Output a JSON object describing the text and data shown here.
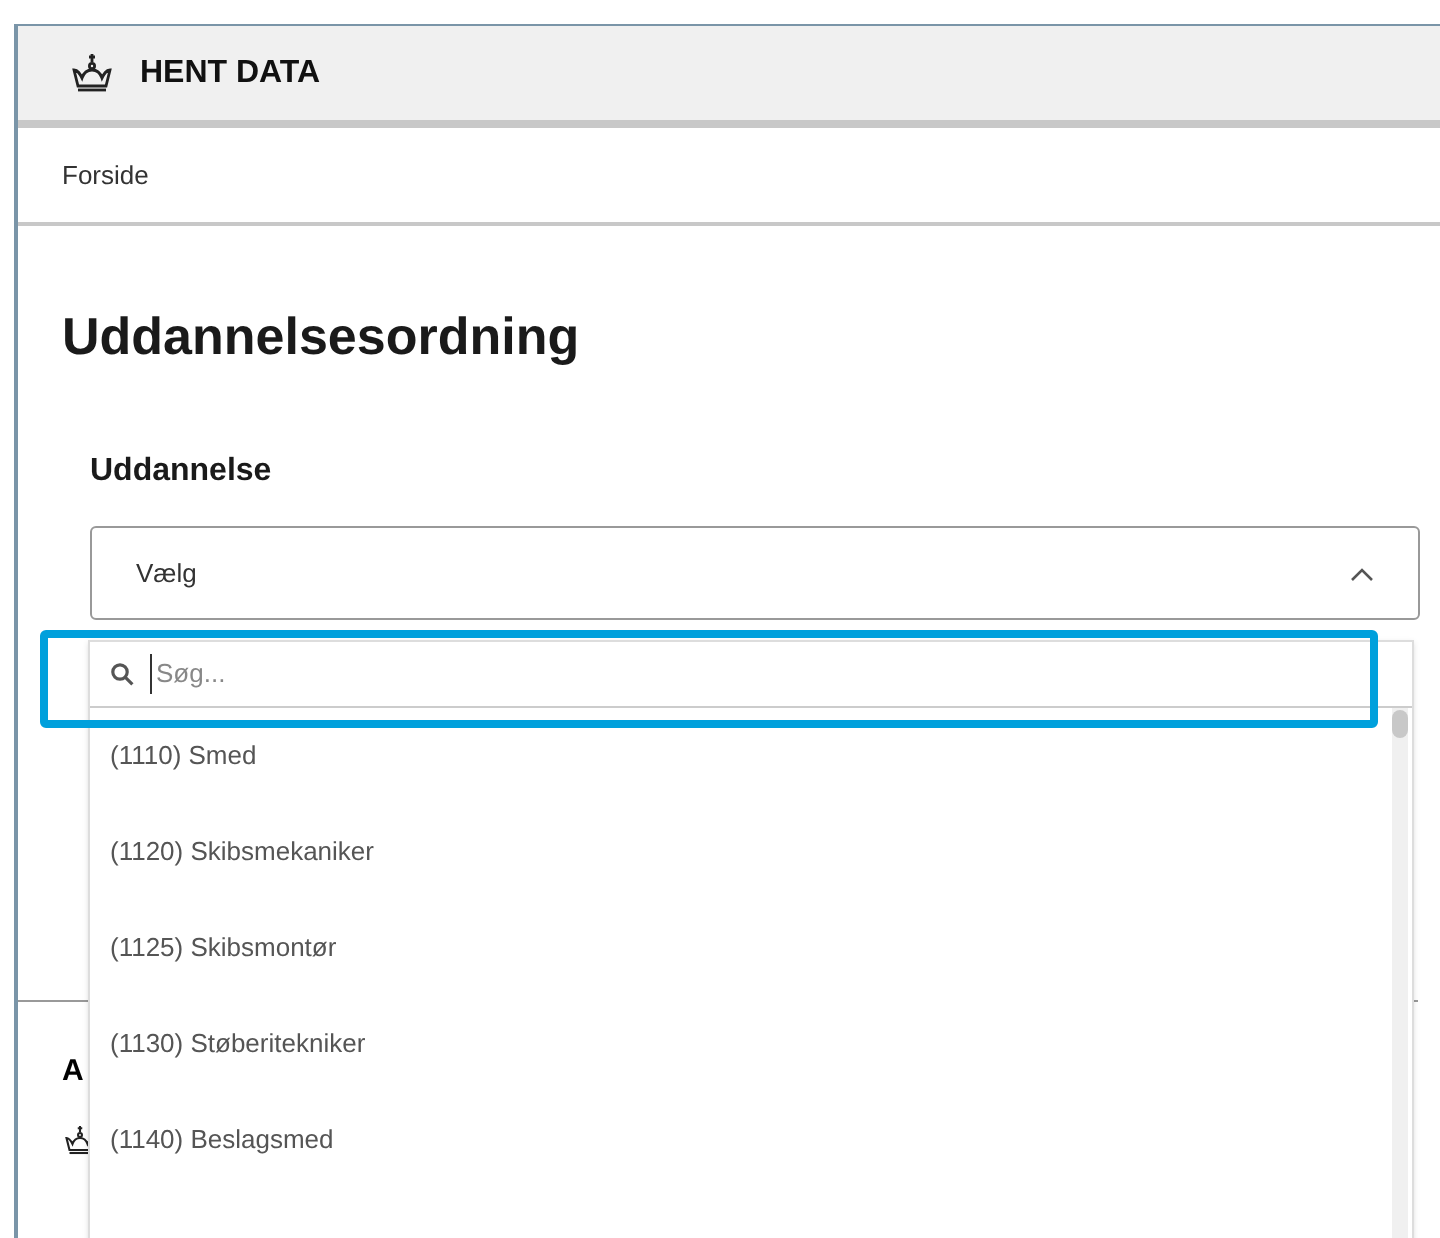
{
  "header": {
    "title": "HENT DATA"
  },
  "breadcrumb": [
    "Forside"
  ],
  "page_title": "Uddannelsesordning",
  "field": {
    "label": "Uddannelse",
    "value": "Vælg",
    "expanded": true
  },
  "footer": {
    "heading": "A"
  },
  "dropdown": {
    "search": {
      "placeholder": "Søg..."
    },
    "options": [
      {
        "label": "(1110) Smed",
        "selected": false
      },
      {
        "label": "(1120) Skibsmekaniker",
        "selected": false
      },
      {
        "label": "(1125) Skibsmontør",
        "selected": false
      },
      {
        "label": "(1130) Støberitekniker",
        "selected": false
      },
      {
        "label": "(1140) Beslagsmed",
        "selected": false
      }
    ]
  }
}
